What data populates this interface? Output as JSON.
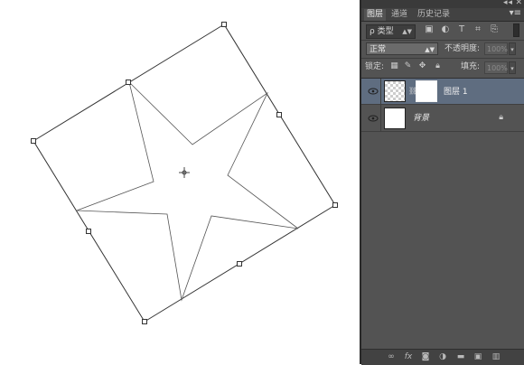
{
  "panel": {
    "collapse_glyph": "◂◂",
    "close_glyph": "✕",
    "tabs": [
      {
        "label": "图层",
        "active": true
      },
      {
        "label": "通道",
        "active": false
      },
      {
        "label": "历史记录",
        "active": false
      }
    ],
    "menu_icon": "panel-menu-icon",
    "filter": {
      "kind_glyph": "ρ",
      "kind_label": "类型",
      "icons": [
        "pixel-filter-icon",
        "adjustment-filter-icon",
        "type-filter-icon",
        "shape-filter-icon",
        "smart-object-filter-icon"
      ]
    },
    "blend_mode": "正常",
    "opacity_label": "不透明度:",
    "opacity_value": "100%",
    "lock_label": "锁定:",
    "lock_icons": [
      "lock-transparency-icon",
      "lock-pixels-icon",
      "lock-position-icon",
      "lock-all-icon"
    ],
    "fill_label": "填充:",
    "fill_value": "100%",
    "layers": [
      {
        "name": "图层 1",
        "selected": true,
        "has_mask": true,
        "visible": true
      },
      {
        "name": "背景",
        "selected": false,
        "locked": true,
        "visible": true
      }
    ],
    "bottom_icons": [
      "link-layers-icon",
      "fx-icon",
      "add-mask-icon",
      "adjustment-layer-icon",
      "new-group-icon",
      "new-layer-icon",
      "delete-layer-icon"
    ]
  },
  "colors": {
    "panel_bg": "#535353",
    "selected_layer": "#5f6d80",
    "canvas_bg": "#ffffff"
  }
}
